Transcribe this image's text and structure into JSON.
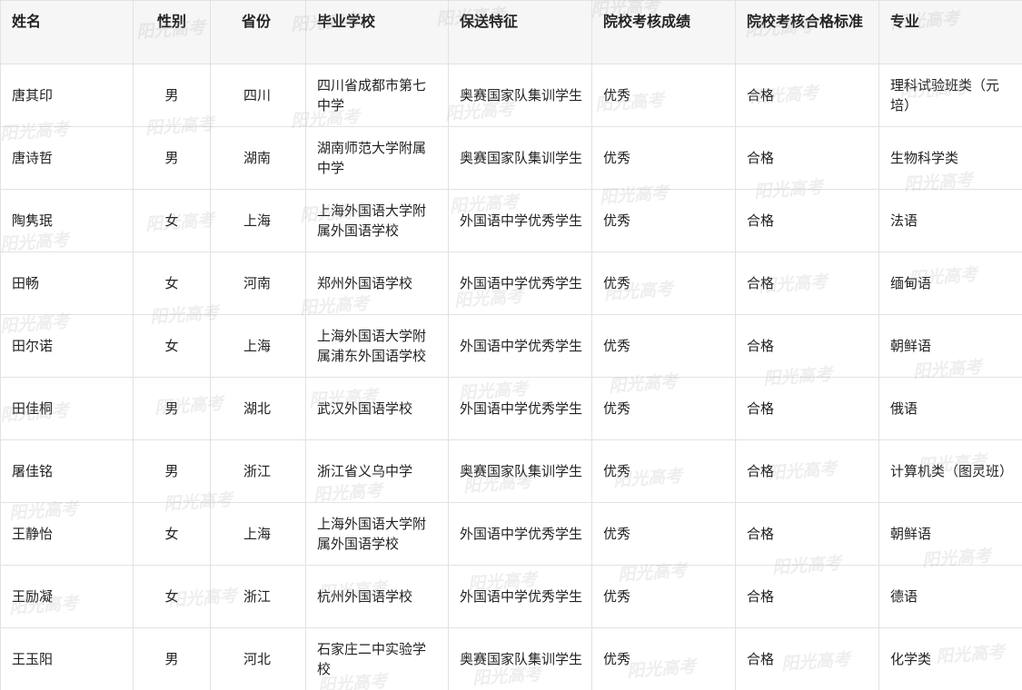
{
  "table": {
    "headers": [
      "姓名",
      "性别",
      "省份",
      "毕业学校",
      "保送特征",
      "院校考核成绩",
      "院校考核合格标准",
      "专业"
    ],
    "rows": [
      [
        "唐其印",
        "男",
        "四川",
        "四川省成都市第七中学",
        "奥赛国家队集训学生",
        "优秀",
        "合格",
        "理科试验班类（元培）"
      ],
      [
        "唐诗哲",
        "男",
        "湖南",
        "湖南师范大学附属中学",
        "奥赛国家队集训学生",
        "优秀",
        "合格",
        "生物科学类"
      ],
      [
        "陶隽珉",
        "女",
        "上海",
        "上海外国语大学附属外国语学校",
        "外国语中学优秀学生",
        "优秀",
        "合格",
        "法语"
      ],
      [
        "田畅",
        "女",
        "河南",
        "郑州外国语学校",
        "外国语中学优秀学生",
        "优秀",
        "合格",
        "缅甸语"
      ],
      [
        "田尔诺",
        "女",
        "上海",
        "上海外国语大学附属浦东外国语学校",
        "外国语中学优秀学生",
        "优秀",
        "合格",
        "朝鲜语"
      ],
      [
        "田佳桐",
        "男",
        "湖北",
        "武汉外国语学校",
        "外国语中学优秀学生",
        "优秀",
        "合格",
        "俄语"
      ],
      [
        "屠佳铭",
        "男",
        "浙江",
        "浙江省义乌中学",
        "奥赛国家队集训学生",
        "优秀",
        "合格",
        "计算机类（图灵班）"
      ],
      [
        "王静怡",
        "女",
        "上海",
        "上海外国语大学附属外国语学校",
        "外国语中学优秀学生",
        "优秀",
        "合格",
        "朝鲜语"
      ],
      [
        "王励凝",
        "女",
        "浙江",
        "杭州外国语学校",
        "外国语中学优秀学生",
        "优秀",
        "合格",
        "德语"
      ],
      [
        "王玉阳",
        "男",
        "河北",
        "石家庄二中实验学校",
        "奥赛国家队集训学生",
        "优秀",
        "合格",
        "化学类"
      ]
    ]
  },
  "watermark": {
    "text": "阳光高考"
  }
}
